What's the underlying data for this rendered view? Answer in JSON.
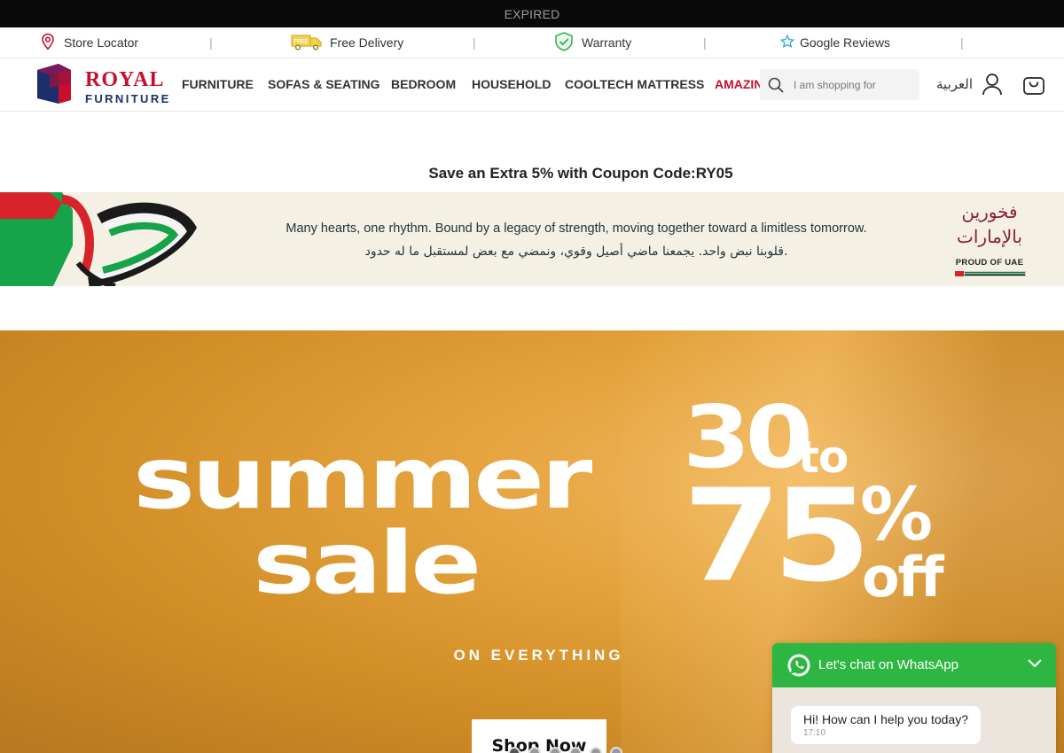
{
  "topbar": {
    "text": "EXPIRED"
  },
  "infobar": {
    "store_locator": "Store Locator",
    "free_delivery": "Free Delivery",
    "free_badge": "FREE",
    "warranty": "Warranty",
    "google_reviews": "Google Reviews",
    "separator": "|"
  },
  "header": {
    "logo_royal": "ROYAL",
    "logo_furniture": "FURNITURE",
    "nav": [
      "FURNITURE",
      "SOFAS & SEATING",
      "BEDROOM",
      "HOUSEHOLD",
      "COOLTECH MATTRESS",
      "AMAZING DE"
    ],
    "search_placeholder": "I am shopping for",
    "language": "العربية"
  },
  "coupon": {
    "text": "Save an Extra 5% with Coupon Code:RY05"
  },
  "uae_banner": {
    "line_en": "Many hearts, one rhythm. Bound by a legacy of strength, moving together toward a limitless tomorrow.",
    "line_ar": "قلوبنا نبض واحد. يجمعنا ماضي أصيل وقوي، ونمضي مع بعض لمستقبل ما له حدود.",
    "badge_ar_1": "فخورين",
    "badge_ar_2": "بالإمارات",
    "badge_en": "PROUD OF UAE",
    "flag_colors": [
      "#d8232a",
      "#00843d",
      "#ffffff",
      "#000000"
    ]
  },
  "hero": {
    "word_summer": "summer",
    "word_sale": "sale",
    "num_30": "30",
    "word_to": "to",
    "num_75": "75",
    "pct": "%",
    "word_off": "off",
    "subtitle": "ON EVERYTHING",
    "cta": "Shop Now",
    "slides_count": 6,
    "active_slide": 1
  },
  "whatsapp": {
    "title": "Let's chat on WhatsApp",
    "message": "Hi! How can I help you today?",
    "time": "17:10",
    "accent": "#2db742"
  }
}
